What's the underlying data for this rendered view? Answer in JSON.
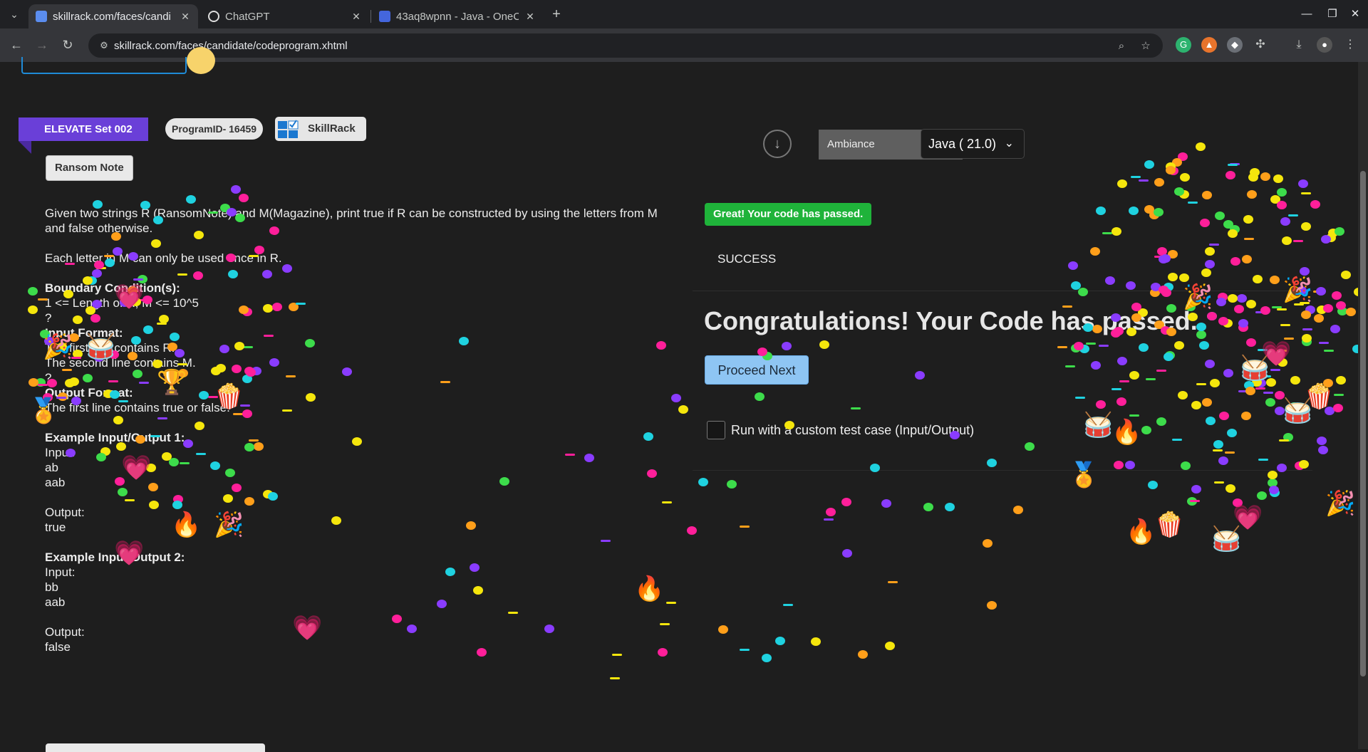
{
  "browser": {
    "tabs": [
      {
        "title": "skillrack.com/faces/candi",
        "active": true
      },
      {
        "title": "ChatGPT",
        "active": false
      },
      {
        "title": "43aq8wpnn - Java - OneC",
        "active": false
      }
    ],
    "url": "skillrack.com/faces/candidate/codeprogram.xhtml",
    "colors": {
      "frame": "#202124",
      "toolbar": "#35363a",
      "omnibox": "#202124"
    }
  },
  "header": {
    "set_label": "ELEVATE Set 002",
    "program_id": "ProgramID- 16459",
    "brand": "SkillRack",
    "problem_title": "Ransom Note"
  },
  "problem": {
    "description": "Given two strings R (RansomNote) and M(Magazine), print true if R can be constructed by using the letters from M and false otherwise.",
    "rule": "Each letter in M can only be used once in R.",
    "boundary_heading": "Boundary Condition(s):",
    "boundary_1": "1 <= Length of R, M <= 10^5",
    "boundary_2": "?",
    "input_heading": "Input Format:",
    "input_1": "The first line contains R.",
    "input_2": "The second line contains M.",
    "input_3": "?",
    "output_heading": "Output Format:",
    "output_1": "The first line contains true or false.",
    "example1_heading": "Example Input/Output 1:",
    "example1_input_label": "Input:",
    "example1_input_1": "ab",
    "example1_input_2": "aab",
    "example1_output_label": "Output:",
    "example1_output": "true",
    "example2_heading": "Example Input/Output 2:",
    "example2_input_label": "Input:",
    "example2_input_1": "bb",
    "example2_input_2": "aab",
    "example2_output_label": "Output:",
    "example2_output": "false"
  },
  "editor": {
    "theme": "Ambiance",
    "language": "Java ( 21.0)"
  },
  "result": {
    "badge": "Great! Your code has passed.",
    "status": "SUCCESS",
    "headline": "Congratulations! Your Code has passed.",
    "proceed": "Proceed Next",
    "custom_test": "Run with a custom test case (Input/Output)"
  },
  "colors": {
    "page_bg": "#1e1e1e",
    "ribbon": "#6a3fd8",
    "success_badge": "#1fb33a",
    "proceed_button": "#8ec5f3"
  },
  "confetti_icons": [
    "party-popper-icon",
    "drum-icon",
    "fire-icon",
    "heart-icon",
    "popcorn-icon",
    "medal-icon",
    "trophy-icon"
  ]
}
